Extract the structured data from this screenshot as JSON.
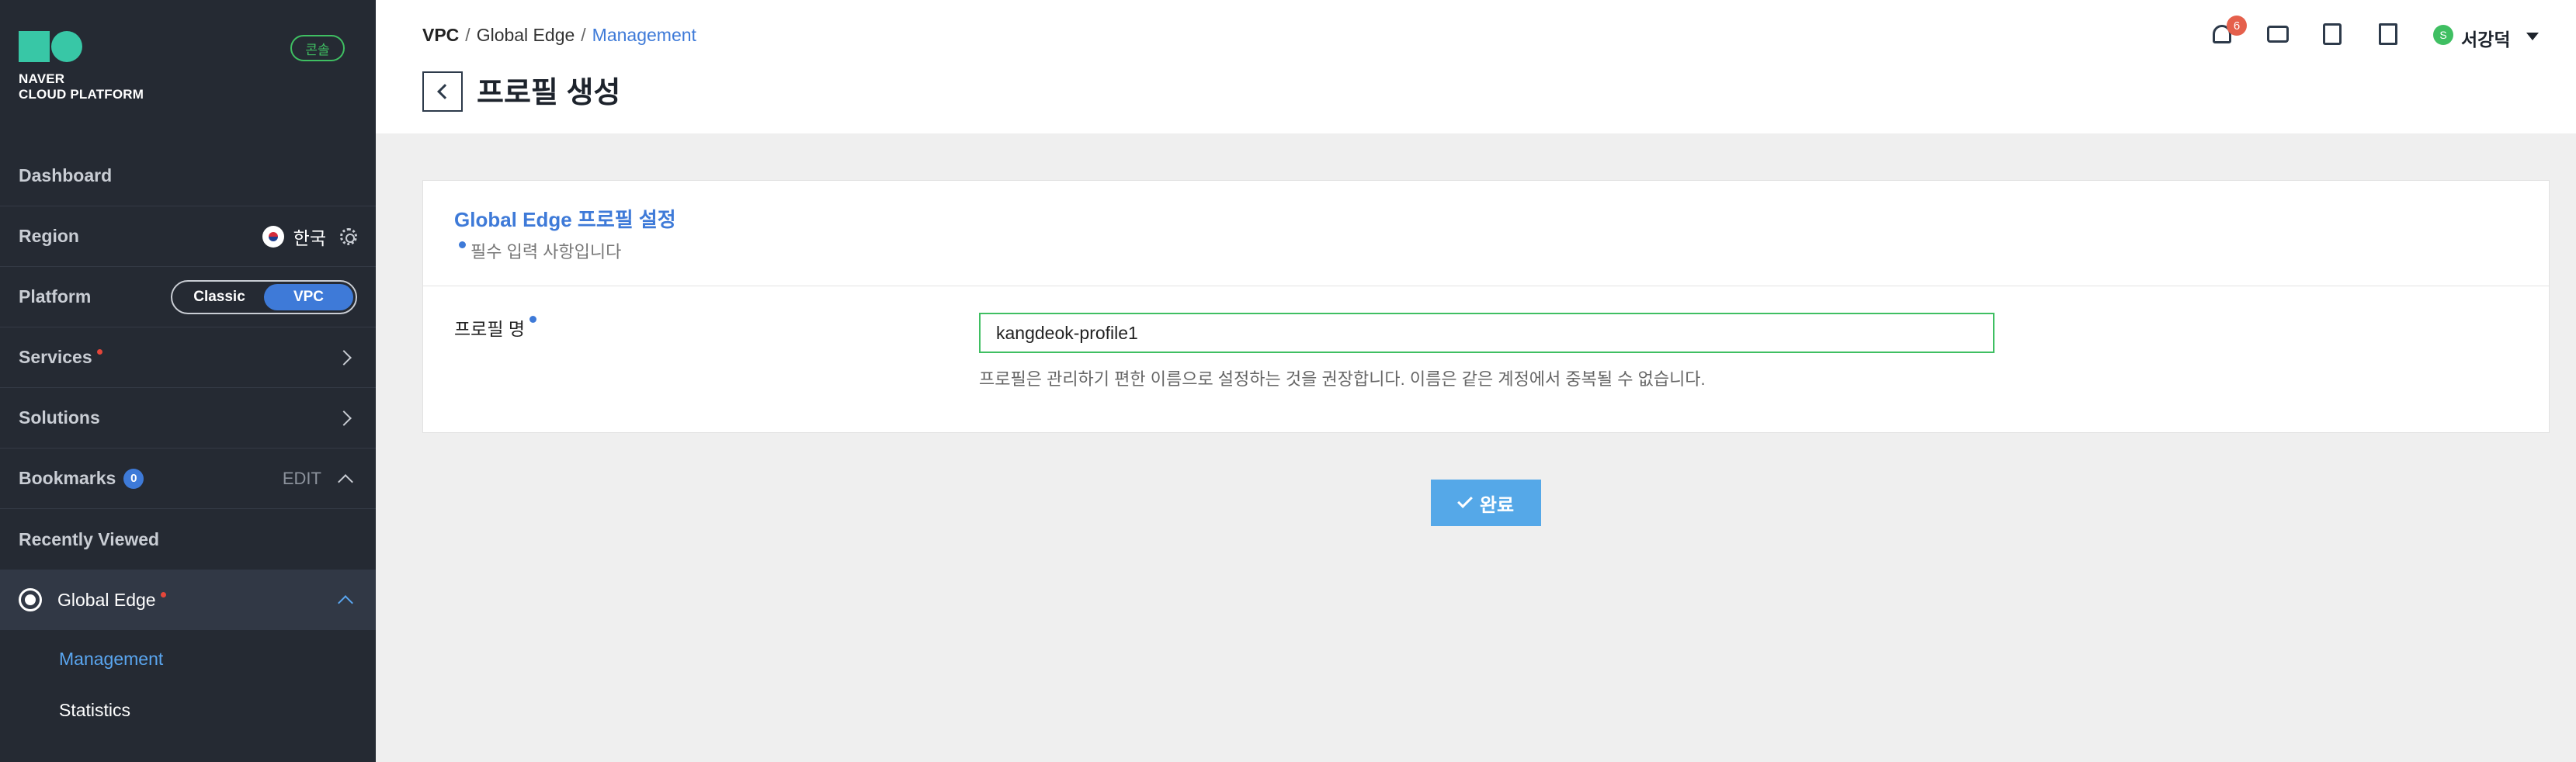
{
  "sidebar": {
    "brand": {
      "line1": "NAVER",
      "line2": "CLOUD PLATFORM"
    },
    "console_badge": "콘솔",
    "dashboard": "Dashboard",
    "region": {
      "label": "Region",
      "value": "한국"
    },
    "platform": {
      "label": "Platform",
      "options": [
        "Classic",
        "VPC"
      ],
      "selected": "VPC"
    },
    "services": "Services",
    "solutions": "Solutions",
    "bookmarks": {
      "label": "Bookmarks",
      "count": "0",
      "edit": "EDIT"
    },
    "recently_viewed": "Recently Viewed",
    "active_service": "Global Edge",
    "sub_items": [
      "Management",
      "Statistics"
    ]
  },
  "header": {
    "breadcrumb": [
      "VPC",
      "Global Edge",
      "Management"
    ],
    "breadcrumb_sep": "/",
    "page_title": "프로필 생성",
    "notification_count": "6",
    "user_initial": "S",
    "user_name": "서강덕"
  },
  "form": {
    "section_title": "Global Edge 프로필 설정",
    "required_note": "필수 입력 사항입니다",
    "profile_name_label": "프로필 명",
    "profile_name_value": "kangdeok-profile1",
    "helper_text": "프로필은 관리하기 편한 이름으로 설정하는 것을 권장합니다. 이름은 같은 계정에서 중복될 수 없습니다.",
    "submit_label": "완료"
  },
  "colors": {
    "sidebar_bg": "#252a33",
    "accent": "#3e7ad8",
    "success": "#3fbf62",
    "button": "#55a8e8"
  }
}
